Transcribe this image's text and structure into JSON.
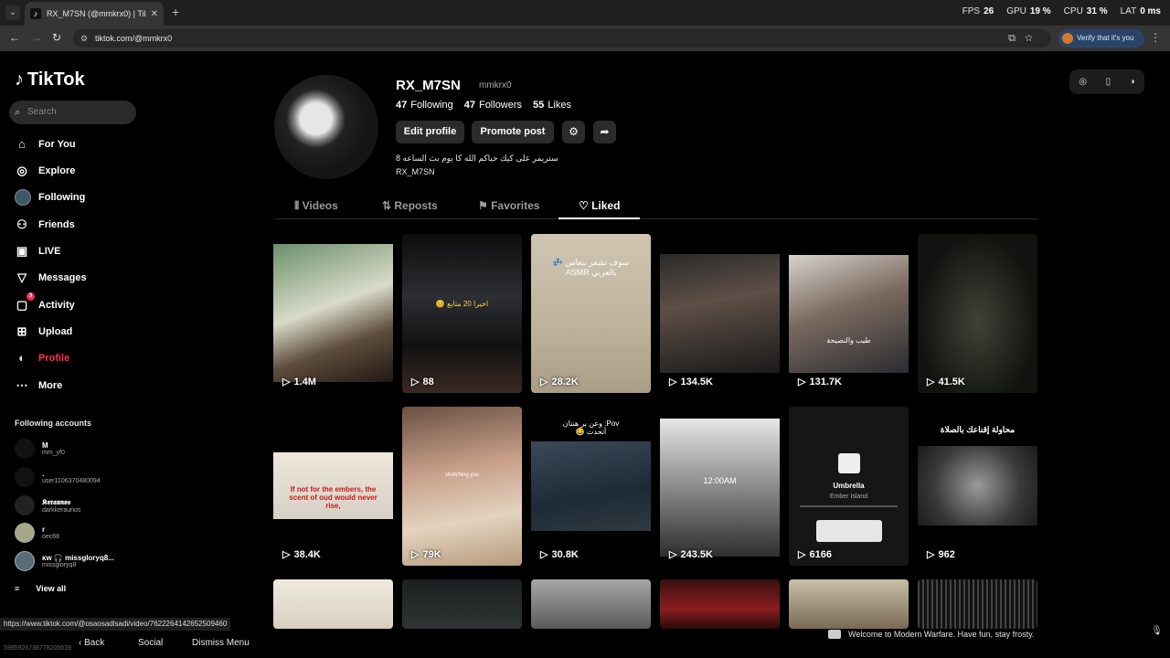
{
  "browser": {
    "tab_title": "RX_M7SN (@mmkrx0) | TikTok",
    "url": "tiktok.com/@mmkrx0",
    "verify_label": "Verify that it's you",
    "stats": [
      {
        "label": "FPS",
        "value": "26"
      },
      {
        "label": "GPU",
        "value": "19 %"
      },
      {
        "label": "CPU",
        "value": "31 %"
      },
      {
        "label": "LAT",
        "value": "0 ms"
      }
    ]
  },
  "sidebar": {
    "logo": "TikTok",
    "search_placeholder": "Search",
    "items": [
      {
        "label": "For You",
        "icon": "home-icon"
      },
      {
        "label": "Explore",
        "icon": "compass-icon"
      },
      {
        "label": "Following",
        "icon": "avatar-icon"
      },
      {
        "label": "Friends",
        "icon": "friends-icon"
      },
      {
        "label": "LIVE",
        "icon": "live-icon"
      },
      {
        "label": "Messages",
        "icon": "messages-icon"
      },
      {
        "label": "Activity",
        "icon": "activity-icon",
        "badge": "3"
      },
      {
        "label": "Upload",
        "icon": "upload-icon"
      },
      {
        "label": "Profile",
        "icon": "profile-icon"
      },
      {
        "label": "More",
        "icon": "more-icon"
      }
    ],
    "following_title": "Following accounts",
    "following": [
      {
        "name": "M",
        "handle": "mm_yf0"
      },
      {
        "name": ".",
        "handle": "user1106370480094"
      },
      {
        "name": "𝕶𝖊𝖗𝖆𝖚𝖓𝖔𝖘",
        "handle": "darkkeraunos"
      },
      {
        "name": "r",
        "handle": "oec68"
      },
      {
        "name": "ĸw 🎧 missgloryq8...",
        "handle": "missgloryq8"
      }
    ],
    "view_all": "View all"
  },
  "profile": {
    "username": "RX_M7SN",
    "handle": "mmkrx0",
    "following_count": "47",
    "following_label": "Following",
    "followers_count": "47",
    "followers_label": "Followers",
    "likes_count": "55",
    "likes_label": "Likes",
    "edit_label": "Edit profile",
    "promote_label": "Promote post",
    "bio_line1": "ستريمر على كيك حياكم الله كا يوم بث الساعه 8",
    "bio_line2": "RX_M7SN"
  },
  "tabs": [
    "Videos",
    "Reposts",
    "Favorites",
    "Liked"
  ],
  "videos": [
    {
      "views": "1.4M",
      "caption": ""
    },
    {
      "views": "88",
      "caption": "اخيرا 20 متابع 😊"
    },
    {
      "views": "28.2K",
      "caption": "سوف تشعر بنعاس 💤 بالعربي ASMR"
    },
    {
      "views": "134.5K",
      "caption": ""
    },
    {
      "views": "131.7K",
      "caption": "طيب والنصيحة"
    },
    {
      "views": "41.5K",
      "caption": ""
    },
    {
      "views": "38.4K",
      "caption": "If not for the embers, the scent of oud would never rise,"
    },
    {
      "views": "79K",
      "caption": "stretching you"
    },
    {
      "views": "30.8K",
      "caption": "Pov: وعن بر هنتان أتحدث 😂"
    },
    {
      "views": "243.5K",
      "caption": "12:00AM"
    },
    {
      "views": "6166",
      "caption": "Umbrella"
    },
    {
      "views": "962",
      "caption": "محاولة إقناعك بالصلاة"
    }
  ],
  "player": {
    "song": "Umbrella",
    "artist": "Ember Island"
  },
  "status_url": "https://www.tiktok.com/@osaosadlsadi/video/7622264142652509460",
  "bottom_buttons": [
    "Back",
    "Social",
    "Dismiss Menu"
  ],
  "ghost_id": "5995926738778205639",
  "toast": "Welcome to Modern Warfare. Have fun, stay frosty."
}
